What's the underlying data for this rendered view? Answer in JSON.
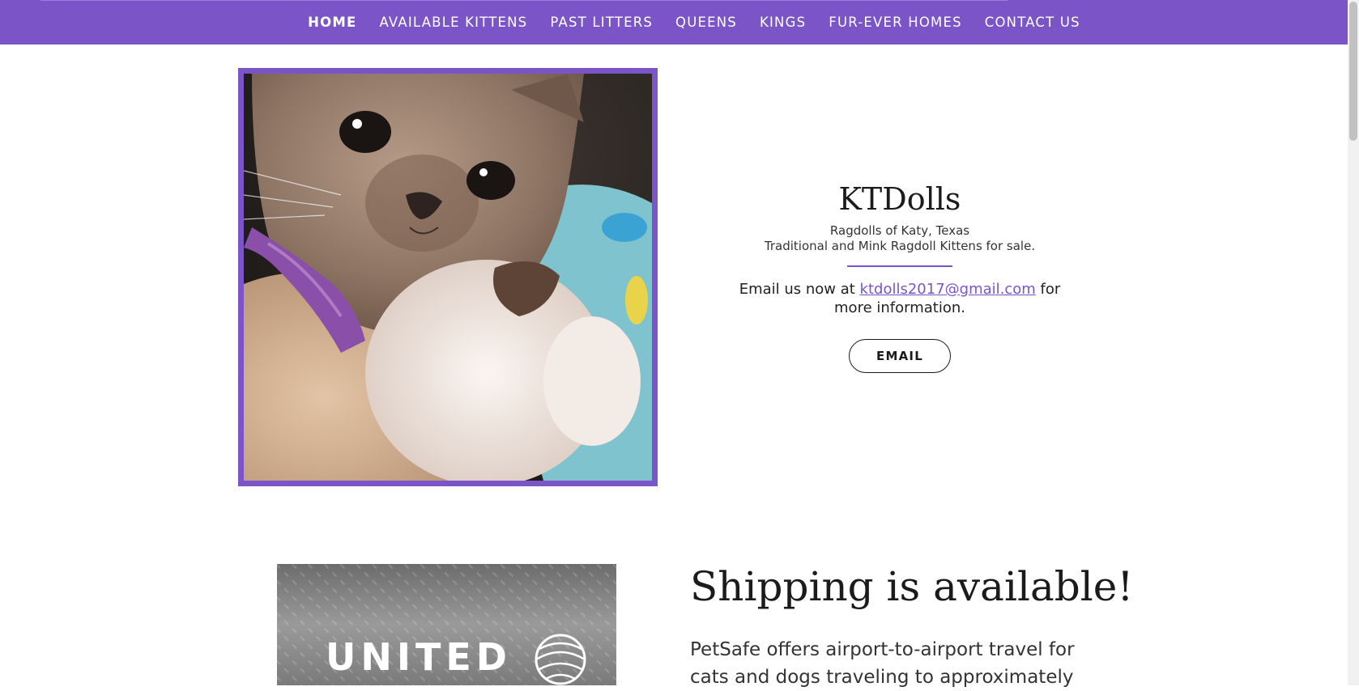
{
  "nav": {
    "items": [
      {
        "label": "HOME"
      },
      {
        "label": "AVAILABLE KITTENS"
      },
      {
        "label": "PAST LITTERS"
      },
      {
        "label": "QUEENS"
      },
      {
        "label": "KINGS"
      },
      {
        "label": "FUR-EVER HOMES"
      },
      {
        "label": "CONTACT US"
      }
    ]
  },
  "hero": {
    "title": "KTDolls",
    "tagline_1": "Ragdolls of Katy, Texas",
    "tagline_2": "Traditional and Mink Ragdoll Kittens for sale.",
    "email_prefix": "Email us now at ",
    "email_address": "ktdolls2017@gmail.com",
    "email_suffix": " for more information.",
    "button_label": "EMAIL"
  },
  "shipping": {
    "title": "Shipping is available!",
    "body": " PetSafe  offers airport-to-airport travel for cats and dogs traveling to  approximately",
    "logo_text": "UNITED"
  },
  "colors": {
    "accent": "#7b55c7",
    "text": "#1b1b1b"
  }
}
